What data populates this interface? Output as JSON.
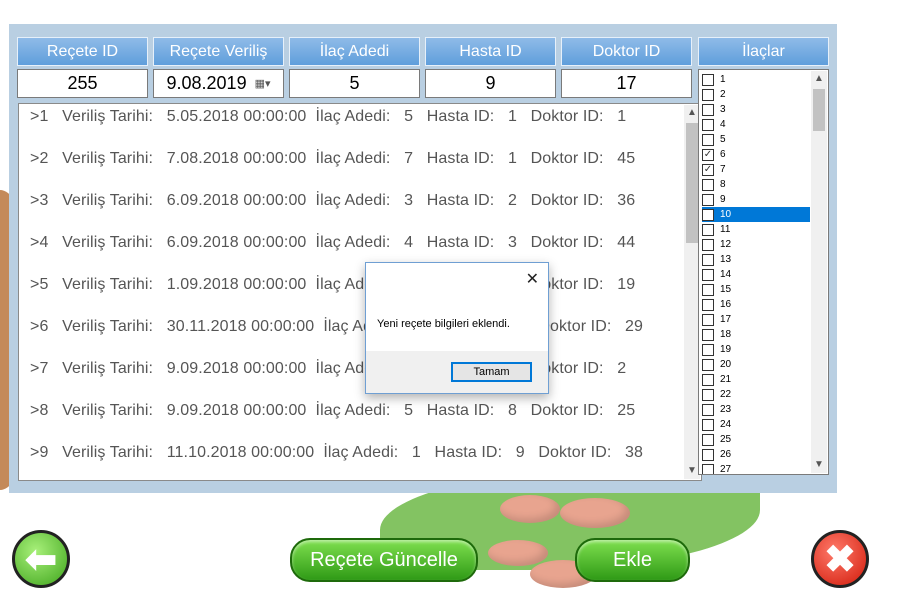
{
  "headers": {
    "recete_id": "Reçete ID",
    "recete_verilis": "Reçete Veriliş",
    "ilac_adedi": "İlaç Adedi",
    "hasta_id": "Hasta ID",
    "doktor_id": "Doktor ID",
    "ilaclar": "İlaçlar"
  },
  "inputs": {
    "recete_id": "255",
    "recete_verilis": "9.08.2019",
    "ilac_adedi": "5",
    "hasta_id": "9",
    "doktor_id": "17"
  },
  "records": [
    ">1   Veriliş Tarihi:   5.05.2018 00:00:00  İlaç Adedi:   5   Hasta ID:   1   Doktor ID:   1",
    ">2   Veriliş Tarihi:   7.08.2018 00:00:00  İlaç Adedi:   7   Hasta ID:   1   Doktor ID:   45",
    ">3   Veriliş Tarihi:   6.09.2018 00:00:00  İlaç Adedi:   3   Hasta ID:   2   Doktor ID:   36",
    ">4   Veriliş Tarihi:   6.09.2018 00:00:00  İlaç Adedi:   4   Hasta ID:   3   Doktor ID:   44",
    ">5   Veriliş Tarihi:   1.09.2018 00:00:00  İlaç Adedi:   ?   Hasta ID:   ?   Doktor ID:   19",
    ">6   Veriliş Tarihi:   30.11.2018 00:00:00  İlaç Adedi:   ?   Hasta ID:   ?   Doktor ID:   29",
    ">7   Veriliş Tarihi:   9.09.2018 00:00:00  İlaç Adedi:   ?   Hasta ID:   ?   Doktor ID:   2",
    ">8   Veriliş Tarihi:   9.09.2018 00:00:00  İlaç Adedi:   5   Hasta ID:   8   Doktor ID:   25",
    ">9   Veriliş Tarihi:   11.10.2018 00:00:00  İlaç Adedi:   1   Hasta ID:   9   Doktor ID:   38"
  ],
  "drugs": [
    {
      "label": "1",
      "checked": false
    },
    {
      "label": "2",
      "checked": false
    },
    {
      "label": "3",
      "checked": false
    },
    {
      "label": "4",
      "checked": false
    },
    {
      "label": "5",
      "checked": false
    },
    {
      "label": "6",
      "checked": true
    },
    {
      "label": "7",
      "checked": true
    },
    {
      "label": "8",
      "checked": false
    },
    {
      "label": "9",
      "checked": false
    },
    {
      "label": "10",
      "checked": false,
      "selected": true
    },
    {
      "label": "11",
      "checked": false
    },
    {
      "label": "12",
      "checked": false
    },
    {
      "label": "13",
      "checked": false
    },
    {
      "label": "14",
      "checked": false
    },
    {
      "label": "15",
      "checked": false
    },
    {
      "label": "16",
      "checked": false
    },
    {
      "label": "17",
      "checked": false
    },
    {
      "label": "18",
      "checked": false
    },
    {
      "label": "19",
      "checked": false
    },
    {
      "label": "20",
      "checked": false
    },
    {
      "label": "21",
      "checked": false
    },
    {
      "label": "22",
      "checked": false
    },
    {
      "label": "23",
      "checked": false
    },
    {
      "label": "24",
      "checked": false
    },
    {
      "label": "25",
      "checked": false
    },
    {
      "label": "26",
      "checked": false
    },
    {
      "label": "27",
      "checked": false
    }
  ],
  "dialog": {
    "message": "Yeni reçete bilgileri eklendi.",
    "ok_label": "Tamam",
    "close_glyph": "✕"
  },
  "buttons": {
    "update_label": "Reçete Güncelle",
    "add_label": "Ekle"
  },
  "icons": {
    "back": "arrow-left-icon",
    "close": "close-x-icon",
    "date_dropdown": "calendar-dropdown-icon"
  }
}
